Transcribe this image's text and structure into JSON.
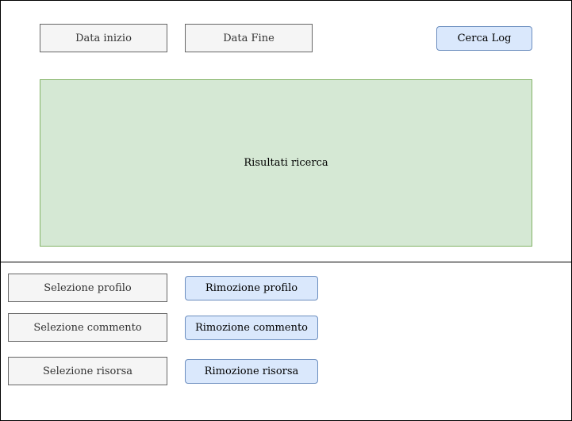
{
  "search": {
    "start_date": "Data inizio",
    "end_date": "Data Fine",
    "search_button": "Cerca Log",
    "results": "Risultati ricerca"
  },
  "moderation": {
    "profile_select": "Selezione profilo",
    "profile_remove": "Rimozione profilo",
    "comment_select": "Selezione commento",
    "comment_remove": "Rimozione commento",
    "resource_select": "Selezione risorsa",
    "resource_remove": "Rimozione risorsa"
  },
  "colors": {
    "field_fill": "#f5f5f5",
    "field_border": "#666666",
    "button_fill": "#dae8fc",
    "button_border": "#6c8ebf",
    "results_fill": "#d5e8d4",
    "results_border": "#82b366"
  }
}
